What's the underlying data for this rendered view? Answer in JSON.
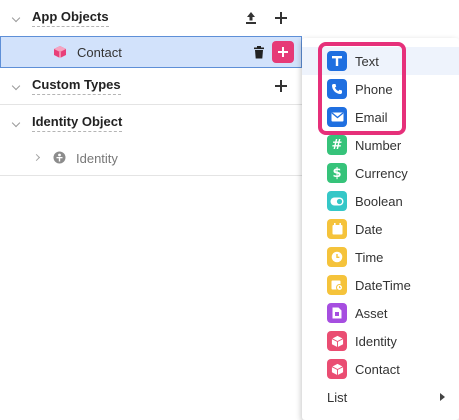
{
  "tree": {
    "app_objects": {
      "title": "App Objects",
      "items": [
        {
          "label": "Contact"
        }
      ]
    },
    "custom_types": {
      "title": "Custom Types"
    },
    "identity_object": {
      "title": "Identity Object",
      "items": [
        {
          "label": "Identity"
        }
      ]
    }
  },
  "menu": {
    "items": [
      {
        "label": "Text",
        "icon": "text-icon",
        "color": "#1f6fe0",
        "glyph": "T"
      },
      {
        "label": "Phone",
        "icon": "phone-icon",
        "color": "#1f6fe0",
        "glyph": "✆"
      },
      {
        "label": "Email",
        "icon": "email-icon",
        "color": "#1f6fe0",
        "glyph": "✉"
      },
      {
        "label": "Number",
        "icon": "number-icon",
        "color": "#36c37a",
        "glyph": "#"
      },
      {
        "label": "Currency",
        "icon": "currency-icon",
        "color": "#36c37a",
        "glyph": "$"
      },
      {
        "label": "Boolean",
        "icon": "toggle-icon",
        "color": "#35c7c7",
        "glyph": ""
      },
      {
        "label": "Date",
        "icon": "calendar-icon",
        "color": "#f5c33b",
        "glyph": ""
      },
      {
        "label": "Time",
        "icon": "clock-icon",
        "color": "#f5c33b",
        "glyph": ""
      },
      {
        "label": "DateTime",
        "icon": "datetime-icon",
        "color": "#f5c33b",
        "glyph": ""
      },
      {
        "label": "Asset",
        "icon": "asset-icon",
        "color": "#a64ee0",
        "glyph": ""
      },
      {
        "label": "Identity",
        "icon": "identity-cube-icon",
        "color": "#ea4d72",
        "glyph": ""
      },
      {
        "label": "Contact",
        "icon": "contact-cube-icon",
        "color": "#ea4d72",
        "glyph": ""
      }
    ],
    "list_label": "List"
  }
}
